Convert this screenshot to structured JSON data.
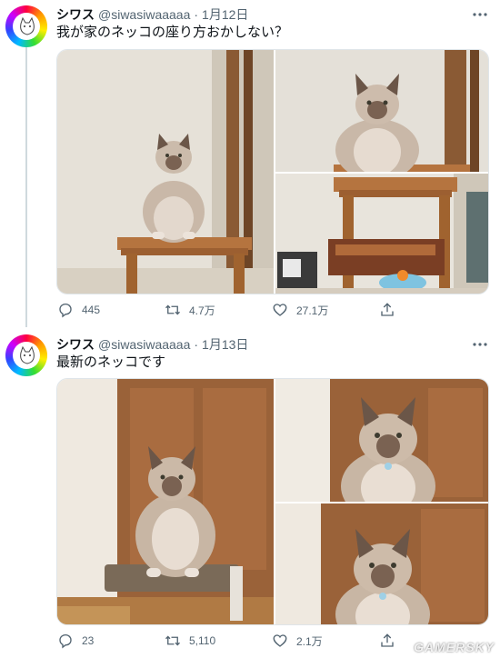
{
  "tweets": [
    {
      "author_name": "シワス",
      "handle": "@siwasiwaaaaa",
      "separator": "·",
      "date": "1月12日",
      "text": "我が家のネッコの座り方おかしない？",
      "stats": {
        "replies": "445",
        "retweets": "4.7万",
        "likes": "27.1万"
      },
      "media": [
        {
          "description": "cat-sitting-on-wooden-stool"
        },
        {
          "description": "cat-upper-body-closeup"
        },
        {
          "description": "wooden-stool-and-pet-food"
        }
      ]
    },
    {
      "author_name": "シワス",
      "handle": "@siwasiwaaaaa",
      "separator": "·",
      "date": "1月13日",
      "text": "最新のネッコです",
      "stats": {
        "replies": "23",
        "retweets": "5,110",
        "likes": "2.1万"
      },
      "media": [
        {
          "description": "cat-sitting-on-cushion"
        },
        {
          "description": "cat-face-closeup"
        },
        {
          "description": "cat-face-closeup-2"
        }
      ]
    }
  ],
  "watermark": "GAMERSKY",
  "icons": {
    "reply": "reply-icon",
    "retweet": "retweet-icon",
    "like": "heart-icon",
    "share": "share-icon",
    "more": "more-icon"
  },
  "colors": {
    "text_primary": "#0f1419",
    "text_secondary": "#536471",
    "border": "#dfe5e9"
  }
}
